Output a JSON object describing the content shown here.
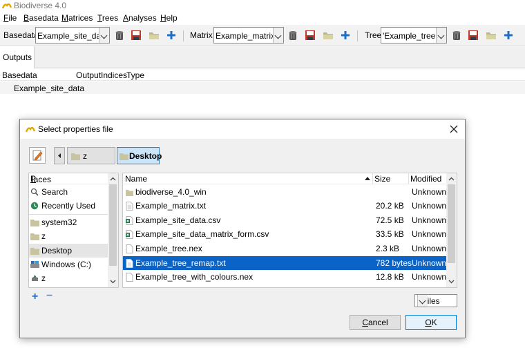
{
  "window": {
    "title": "Biodiverse 4.0"
  },
  "menu": [
    {
      "label": "File",
      "ul": "F",
      "rest": "ile"
    },
    {
      "label": "Basedata",
      "ul": "B",
      "rest": "asedata"
    },
    {
      "label": "Matrices",
      "ul": "M",
      "rest": "atrices"
    },
    {
      "label": "Trees",
      "ul": "T",
      "rest": "rees"
    },
    {
      "label": "Analyses",
      "ul": "A",
      "rest": "nalyses"
    },
    {
      "label": "Help",
      "ul": "H",
      "rest": "elp"
    }
  ],
  "toolbar": {
    "basedata_label": "Basedata",
    "basedata_value": "Example_site_data",
    "matrix_label": "Matrix",
    "matrix_value": "Example_matrix",
    "tree_label": "Tree",
    "tree_value": "'Example_tree'"
  },
  "tabs": [
    {
      "label": "Outputs"
    }
  ],
  "outputs_table": {
    "headers": [
      "Basedata",
      "Output",
      "Indices",
      "Type"
    ],
    "rows": [
      {
        "basedata": "Example_site_data"
      }
    ]
  },
  "dialog": {
    "title": "Select  properties file",
    "path": [
      "z",
      "Desktop"
    ],
    "places_header_ul": "P",
    "places_header_rest": "laces",
    "places": [
      {
        "label": "Search",
        "icon": "search-icon"
      },
      {
        "label": "Recently Used",
        "icon": "recent-icon"
      },
      {
        "label": "system32",
        "icon": "folder-icon"
      },
      {
        "label": "z",
        "icon": "folder-icon"
      },
      {
        "label": "Desktop",
        "icon": "folder-icon",
        "selected": true
      },
      {
        "label": "Windows (C:)",
        "icon": "drive-icon"
      },
      {
        "label": "z",
        "icon": "usb-icon"
      }
    ],
    "columns": {
      "name": "Name",
      "size": "Size",
      "modified": "Modified"
    },
    "files": [
      {
        "name": "biodiverse_4.0_win",
        "size": "",
        "modified": "Unknown",
        "icon": "folder-icon"
      },
      {
        "name": "Example_matrix.txt",
        "size": "20.2 kB",
        "modified": "Unknown",
        "icon": "text-file-icon"
      },
      {
        "name": "Example_site_data.csv",
        "size": "72.5 kB",
        "modified": "Unknown",
        "icon": "csv-file-icon"
      },
      {
        "name": "Example_site_data_matrix_form.csv",
        "size": "33.5 kB",
        "modified": "Unknown",
        "icon": "csv-file-icon"
      },
      {
        "name": "Example_tree.nex",
        "size": "2.3 kB",
        "modified": "Unknown",
        "icon": "file-icon"
      },
      {
        "name": "Example_tree_remap.txt",
        "size": "782 bytes",
        "modified": "Unknown",
        "icon": "text-file-icon",
        "selected": true
      },
      {
        "name": "Example_tree_with_colours.nex",
        "size": "12.8 kB",
        "modified": "Unknown",
        "icon": "file-icon"
      }
    ],
    "filter": ".* files",
    "cancel_ul": "C",
    "cancel_rest": "ancel",
    "ok_ul": "O",
    "ok_rest": "K",
    "add_symbol": "+",
    "remove_symbol": "−"
  },
  "colors": {
    "selection": "#0a64c8",
    "accent_blue": "#1f6fc5",
    "save_red": "#c0392b"
  }
}
